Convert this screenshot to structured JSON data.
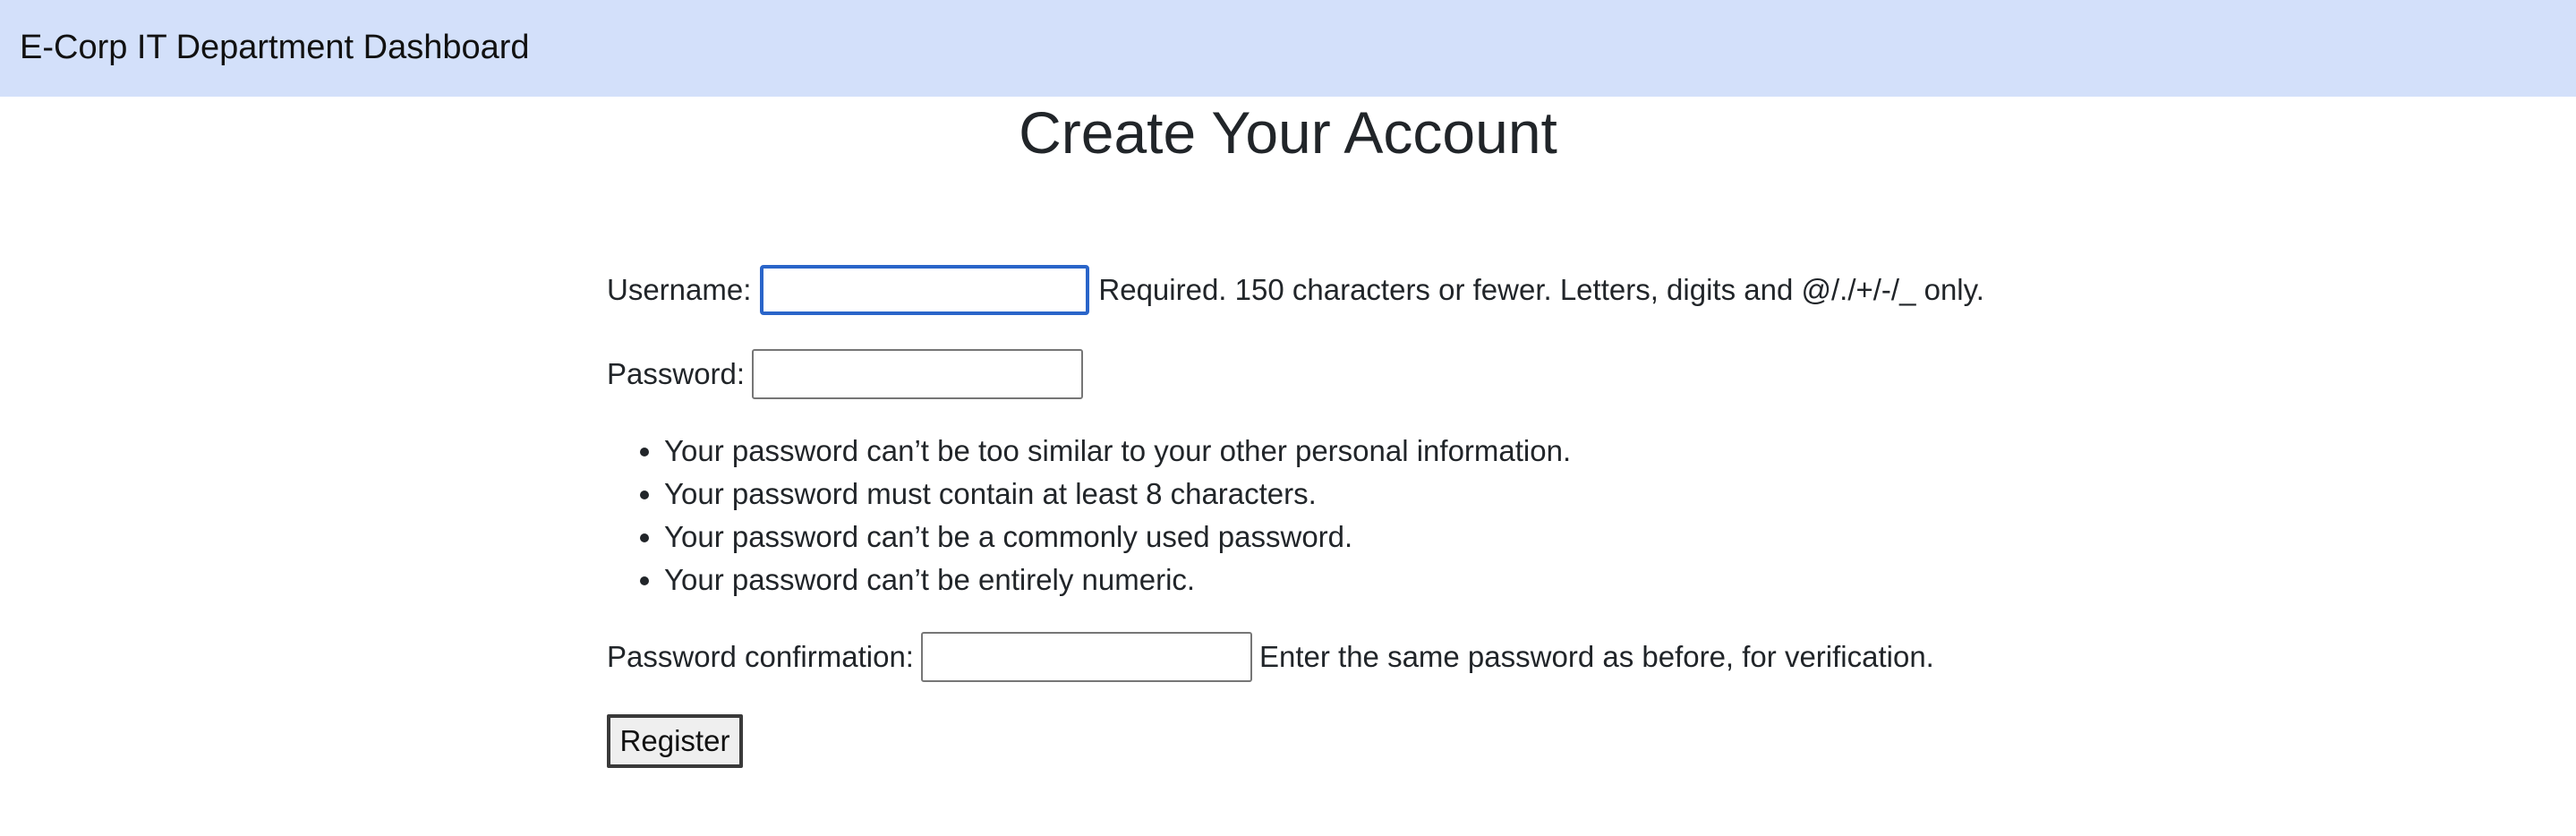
{
  "header": {
    "title": "E-Corp IT Department Dashboard",
    "background": "#d3e0fa"
  },
  "page": {
    "title": "Create Your Account"
  },
  "form": {
    "username": {
      "label": "Username:",
      "value": "",
      "help": "Required. 150 characters or fewer. Letters, digits and @/./+/-/_ only."
    },
    "password": {
      "label": "Password:",
      "value": "",
      "rules": [
        "Your password can’t be too similar to your other personal information.",
        "Your password must contain at least 8 characters.",
        "Your password can’t be a commonly used password.",
        "Your password can’t be entirely numeric."
      ]
    },
    "password_confirmation": {
      "label": "Password confirmation:",
      "value": "",
      "help": "Enter the same password as before, for verification."
    },
    "submit_label": "Register",
    "focus_color": "#2a65c9"
  }
}
